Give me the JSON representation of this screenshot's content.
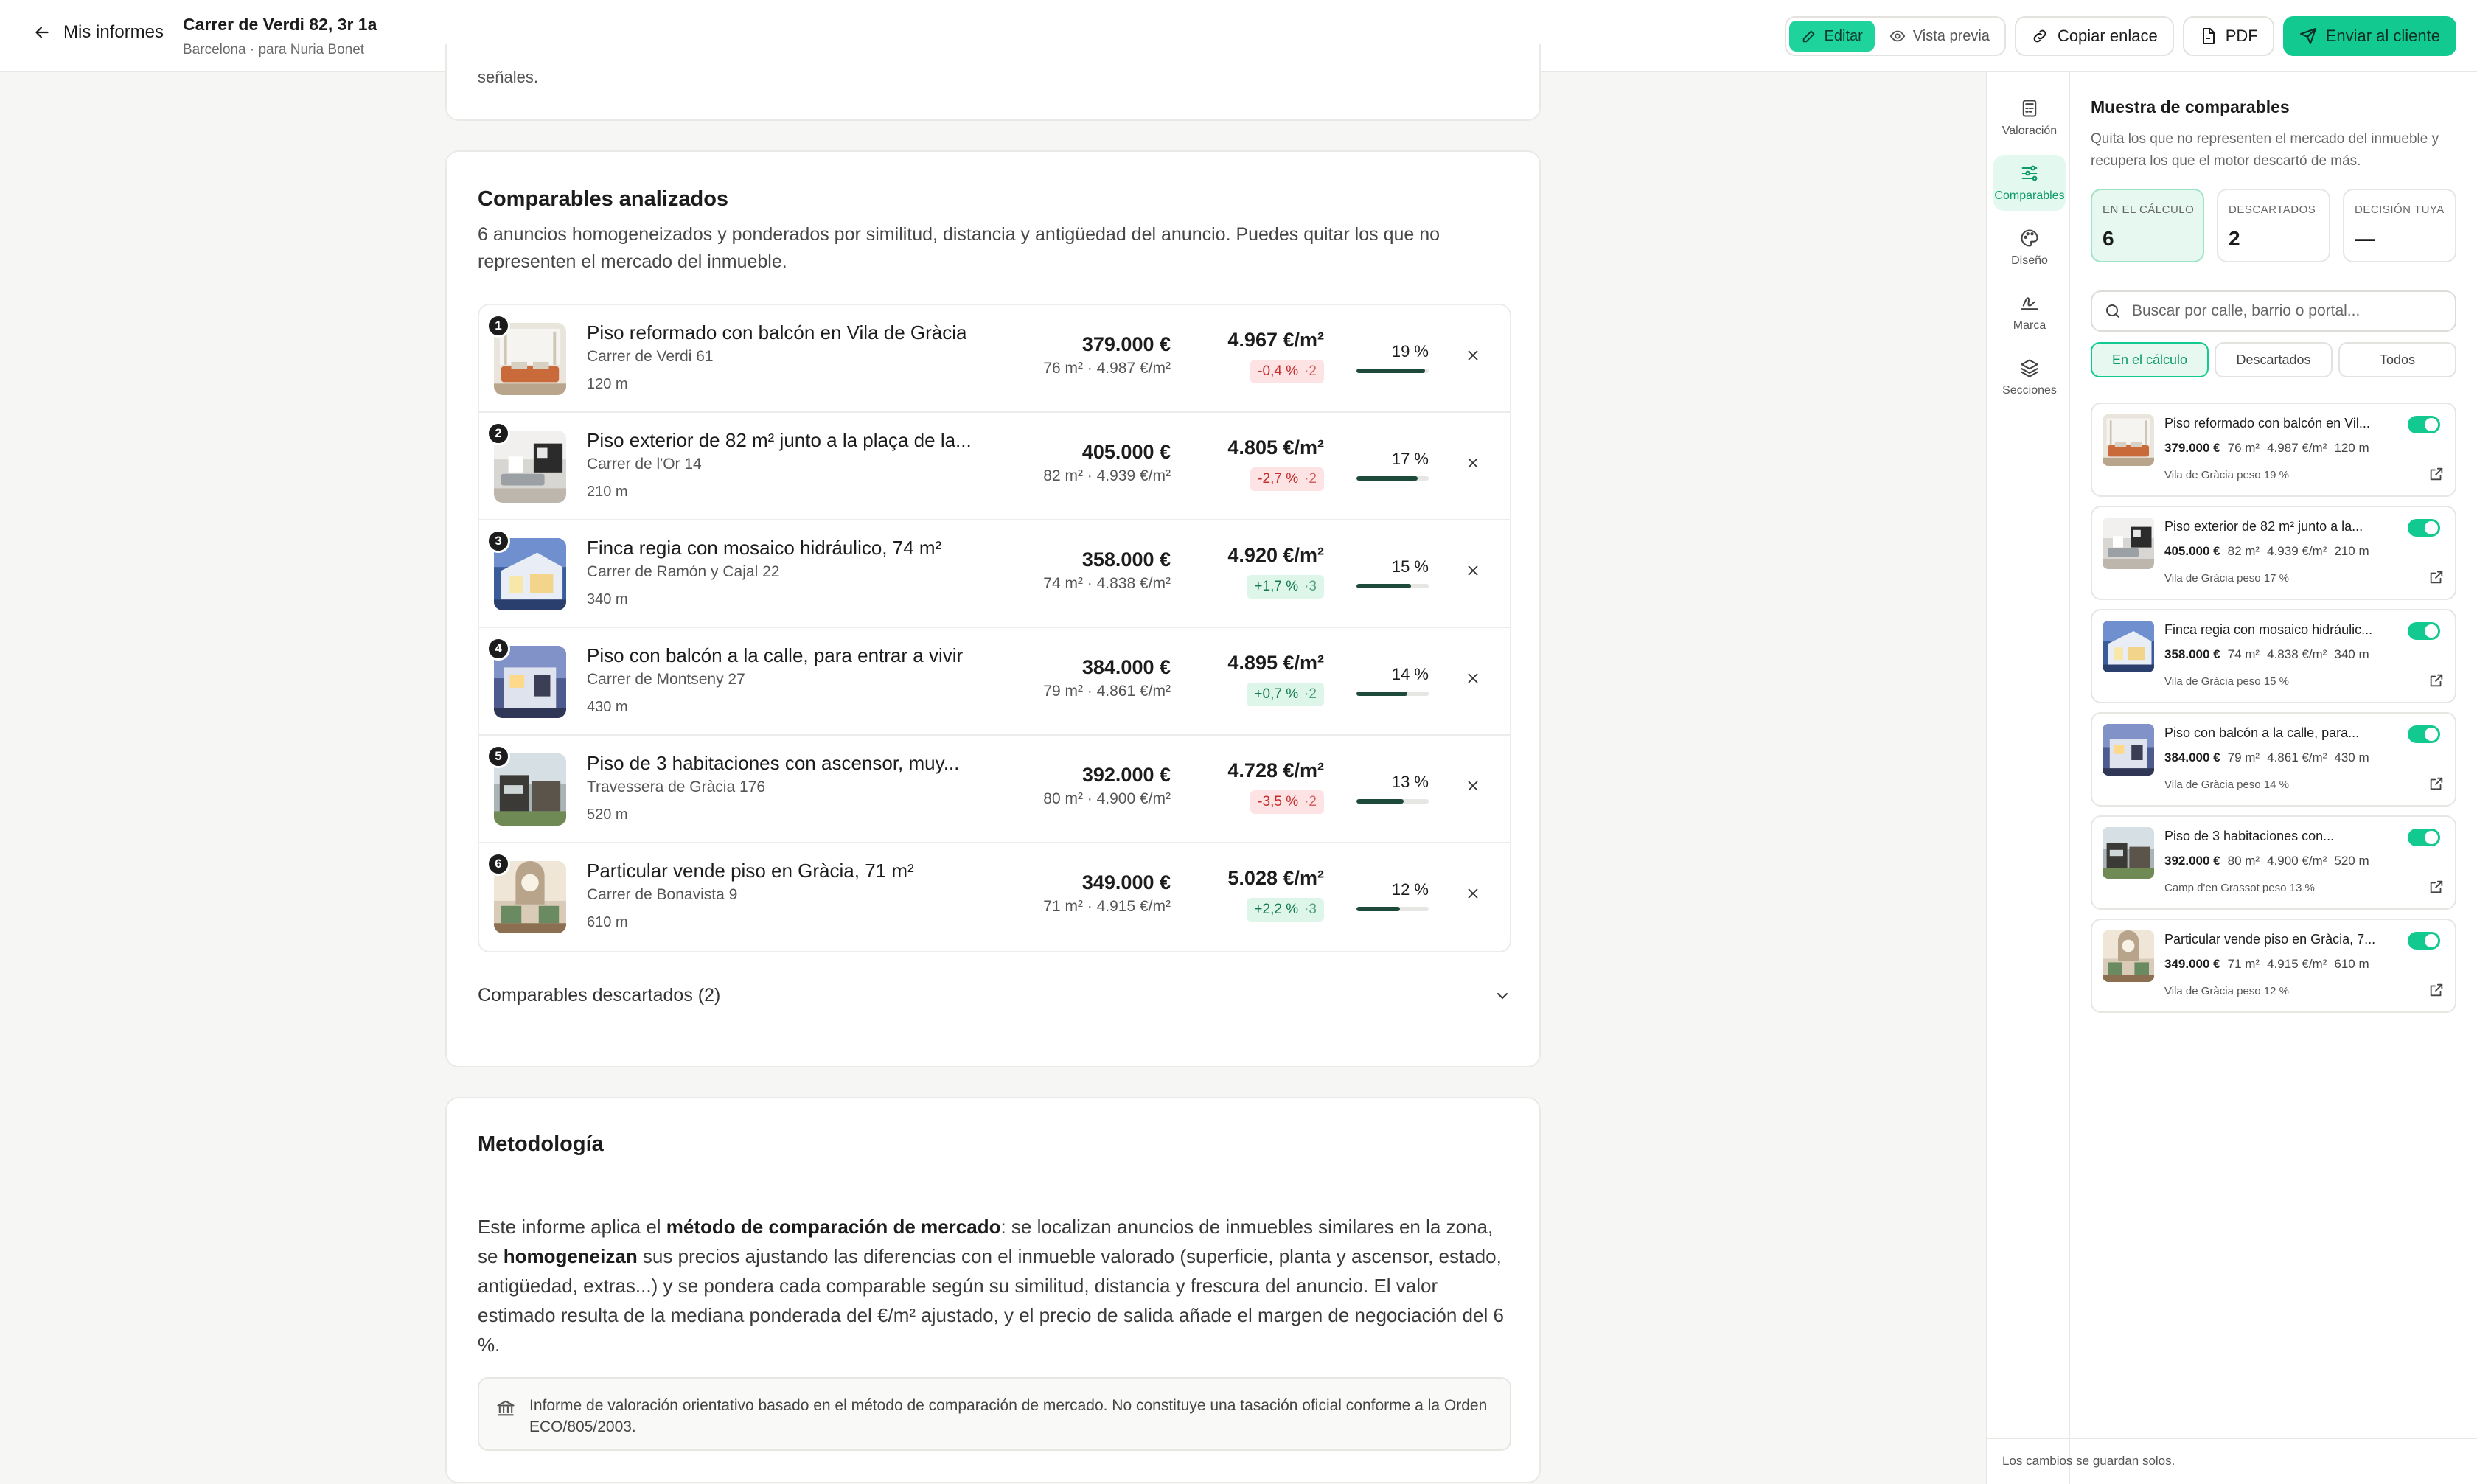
{
  "header": {
    "back_label": "Mis informes",
    "title": "Carrer de Verdi 82, 3r 1a",
    "subtitle": "Barcelona · para Nuria Bonet",
    "mode_edit": "Editar",
    "mode_preview": "Vista previa",
    "copy_link": "Copiar enlace",
    "pdf": "PDF",
    "send": "Enviar al cliente"
  },
  "top_fragment": "señales.",
  "comparables": {
    "title": "Comparables analizados",
    "description": "6 anuncios homogeneizados y ponderados por similitud, distancia y antigüedad del anuncio. Puedes quitar los que no representen el mercado del inmueble.",
    "items": [
      {
        "n": "1",
        "title": "Piso reformado con balcón en Vila de Gràcia",
        "address": "Carrer de Verdi 61",
        "distance": "120 m",
        "price": "379.000 €",
        "m2": "76 m² · 4.987 €/m²",
        "ppm": "4.967 €/m²",
        "delta": "-0,4 %",
        "adj": "·2",
        "weight": "19 %",
        "weight_value": 0.19,
        "positive": false
      },
      {
        "n": "2",
        "title": "Piso exterior de 82 m² junto a la plaça de la...",
        "address": "Carrer de l'Or 14",
        "distance": "210 m",
        "price": "405.000 €",
        "m2": "82 m² · 4.939 €/m²",
        "ppm": "4.805 €/m²",
        "delta": "-2,7 %",
        "adj": "·2",
        "weight": "17 %",
        "weight_value": 0.17,
        "positive": false
      },
      {
        "n": "3",
        "title": "Finca regia con mosaico hidráulico, 74 m²",
        "address": "Carrer de Ramón y Cajal 22",
        "distance": "340 m",
        "price": "358.000 €",
        "m2": "74 m² · 4.838 €/m²",
        "ppm": "4.920 €/m²",
        "delta": "+1,7 %",
        "adj": "·3",
        "weight": "15 %",
        "weight_value": 0.15,
        "positive": true
      },
      {
        "n": "4",
        "title": "Piso con balcón a la calle, para entrar a vivir",
        "address": "Carrer de Montseny 27",
        "distance": "430 m",
        "price": "384.000 €",
        "m2": "79 m² · 4.861 €/m²",
        "ppm": "4.895 €/m²",
        "delta": "+0,7 %",
        "adj": "·2",
        "weight": "14 %",
        "weight_value": 0.14,
        "positive": true
      },
      {
        "n": "5",
        "title": "Piso de 3 habitaciones con ascensor, muy...",
        "address": "Travessera de Gràcia 176",
        "distance": "520 m",
        "price": "392.000 €",
        "m2": "80 m² · 4.900 €/m²",
        "ppm": "4.728 €/m²",
        "delta": "-3,5 %",
        "adj": "·2",
        "weight": "13 %",
        "weight_value": 0.13,
        "positive": false
      },
      {
        "n": "6",
        "title": "Particular vende piso en Gràcia, 71 m²",
        "address": "Carrer de Bonavista 9",
        "distance": "610 m",
        "price": "349.000 €",
        "m2": "71 m² · 4.915 €/m²",
        "ppm": "5.028 €/m²",
        "delta": "+2,2 %",
        "adj": "·3",
        "weight": "12 %",
        "weight_value": 0.12,
        "positive": true
      }
    ],
    "discarded_label": "Comparables descartados (2)"
  },
  "methodology": {
    "title": "Metodología",
    "p_a": "Este informe aplica el ",
    "p_b": "método de comparación de mercado",
    "p_c": ": se localizan anuncios de inmuebles similares en la zona, se ",
    "p_d": "homogeneizan",
    "p_e": " sus precios ajustando las diferencias con el inmueble valorado (superficie, planta y ascensor, estado, antigüedad, extras...) y se pondera cada comparable según su similitud, distancia y frescura del anuncio. El valor estimado resulta de la mediana ponderada del €/m² ajustado, y el precio de salida añade el margen de negociación del 6 %.",
    "note": "Informe de valoración orientativo basado en el método de comparación de mercado. No constituye una tasación oficial conforme a la Orden ECO/805/2003."
  },
  "rail": [
    {
      "label": "Valoración",
      "icon": "calculator-icon"
    },
    {
      "label": "Comparables",
      "icon": "sliders-icon"
    },
    {
      "label": "Diseño",
      "icon": "palette-icon"
    },
    {
      "label": "Marca",
      "icon": "signature-icon"
    },
    {
      "label": "Secciones",
      "icon": "layers-icon"
    }
  ],
  "panel": {
    "title": "Muestra de comparables",
    "description": "Quita los que no representen el mercado del inmueble y recupera los que el motor descartó de más.",
    "stats": [
      {
        "label": "EN EL CÁLCULO",
        "value": "6"
      },
      {
        "label": "DESCARTADOS",
        "value": "2"
      },
      {
        "label": "DECISIÓN TUYA",
        "value": "—"
      }
    ],
    "search_placeholder": "Buscar por calle, barrio o portal...",
    "tabs": [
      "En el cálculo",
      "Descartados",
      "Todos"
    ],
    "items": [
      {
        "title": "Piso reformado con balcón en Vil...",
        "price": "379.000 €",
        "m2": "76 m²",
        "ppm": "4.987 €/m²",
        "dist": "120 m",
        "zone": "Vila de Gràcia  peso 19 %"
      },
      {
        "title": "Piso exterior de 82 m² junto a la...",
        "price": "405.000 €",
        "m2": "82 m²",
        "ppm": "4.939 €/m²",
        "dist": "210 m",
        "zone": "Vila de Gràcia  peso 17 %"
      },
      {
        "title": "Finca regia con mosaico hidráulic...",
        "price": "358.000 €",
        "m2": "74 m²",
        "ppm": "4.838 €/m²",
        "dist": "340 m",
        "zone": "Vila de Gràcia  peso 15 %"
      },
      {
        "title": "Piso con balcón a la calle, para...",
        "price": "384.000 €",
        "m2": "79 m²",
        "ppm": "4.861 €/m²",
        "dist": "430 m",
        "zone": "Vila de Gràcia  peso 14 %"
      },
      {
        "title": "Piso de 3 habitaciones con...",
        "price": "392.000 €",
        "m2": "80 m²",
        "ppm": "4.900 €/m²",
        "dist": "520 m",
        "zone": "Camp d'en Grassot  peso 13 %"
      },
      {
        "title": "Particular vende piso en Gràcia, 7...",
        "price": "349.000 €",
        "m2": "71 m²",
        "ppm": "4.915 €/m²",
        "dist": "610 m",
        "zone": "Vila de Gràcia  peso 12 %"
      }
    ]
  },
  "footer_note": "Los cambios se guardan solos.",
  "colors": {
    "accent": "#12c98f",
    "dark_green": "#1d4a3a",
    "neg_bg": "#fde3e3",
    "pos_bg": "#def6ea"
  }
}
